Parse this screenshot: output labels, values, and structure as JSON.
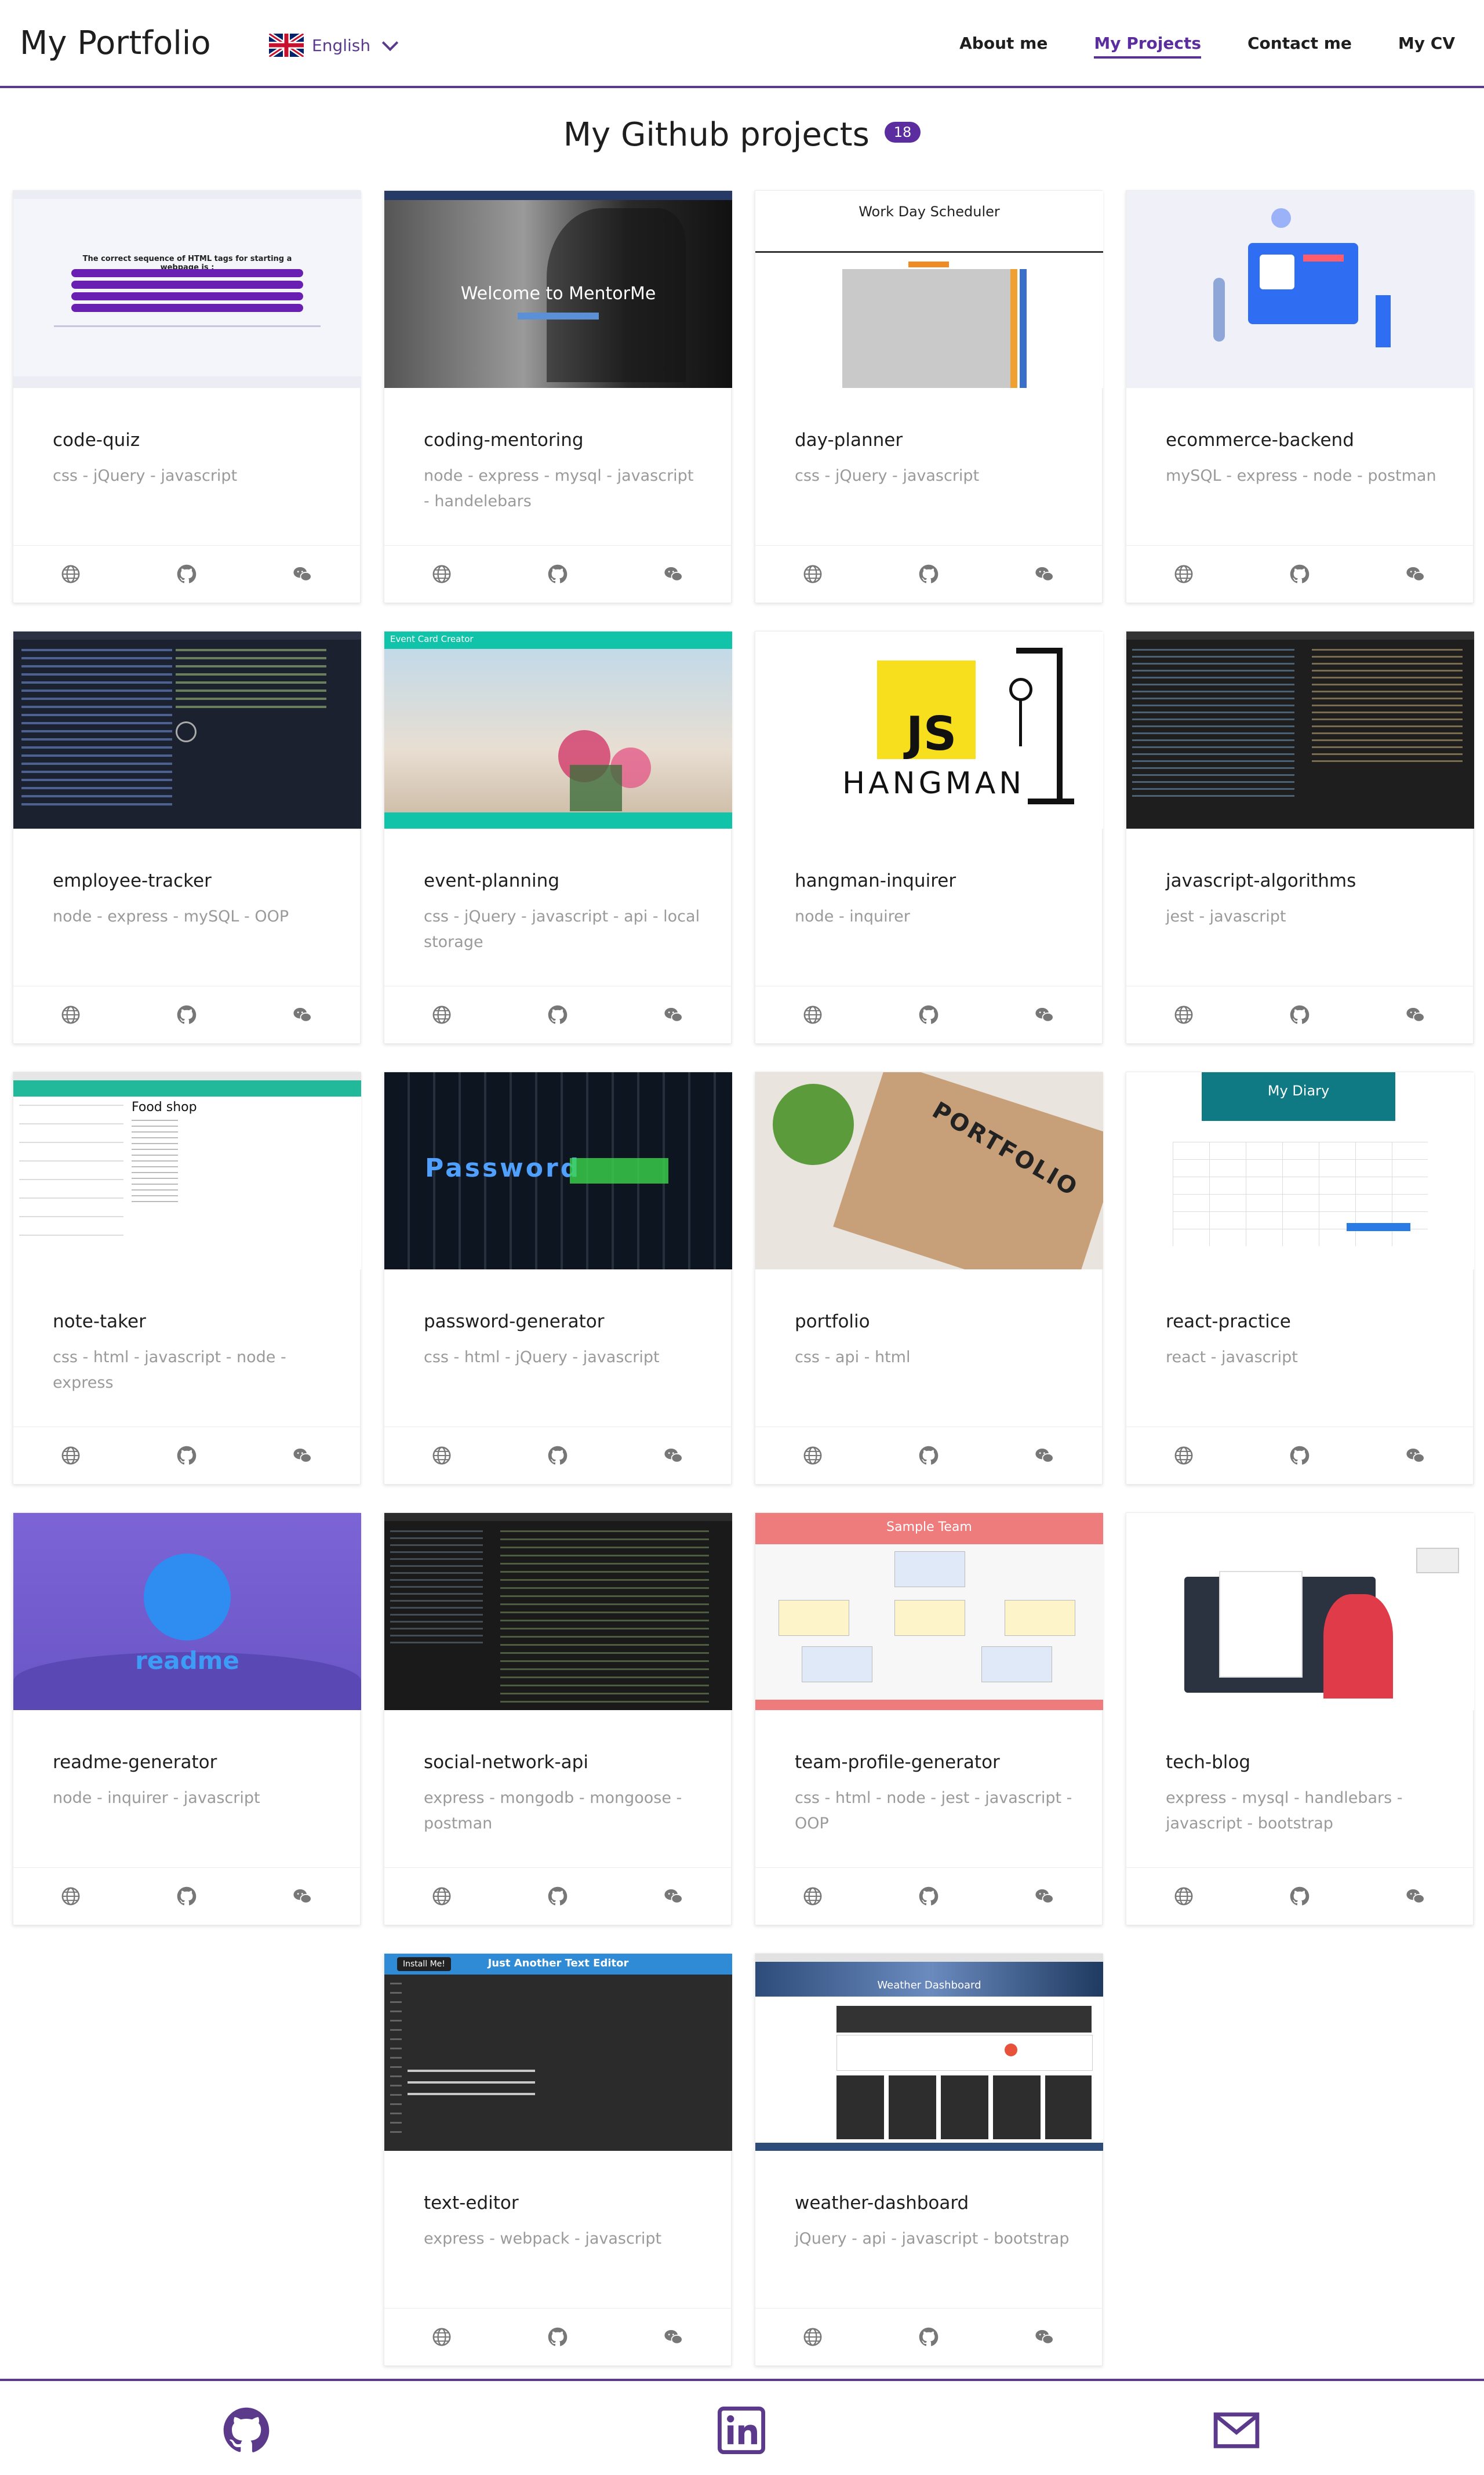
{
  "header": {
    "brand": "My Portfolio",
    "language": "English",
    "nav": [
      "About me",
      "My Projects",
      "Contact me",
      "My CV"
    ],
    "active_nav": "My Projects"
  },
  "section": {
    "title": "My Github projects",
    "count": "18"
  },
  "projects": [
    {
      "name": "code-quiz",
      "tech": "css - jQuery - javascript"
    },
    {
      "name": "coding-mentoring",
      "tech": "node - express - mysql - javascript - handelebars"
    },
    {
      "name": "day-planner",
      "tech": "css - jQuery - javascript"
    },
    {
      "name": "ecommerce-backend",
      "tech": "mySQL - express - node - postman"
    },
    {
      "name": "employee-tracker",
      "tech": "node - express - mySQL - OOP"
    },
    {
      "name": "event-planning",
      "tech": "css - jQuery - javascript - api - local storage"
    },
    {
      "name": "hangman-inquirer",
      "tech": "node - inquirer"
    },
    {
      "name": "javascript-algorithms",
      "tech": "jest - javascript"
    },
    {
      "name": "note-taker",
      "tech": "css - html - javascript - node - express"
    },
    {
      "name": "password-generator",
      "tech": "css - html - jQuery - javascript"
    },
    {
      "name": "portfolio",
      "tech": "css - api - html"
    },
    {
      "name": "react-practice",
      "tech": "react - javascript"
    },
    {
      "name": "readme-generator",
      "tech": "node - inquirer - javascript"
    },
    {
      "name": "social-network-api",
      "tech": "express - mongodb - mongoose - postman"
    },
    {
      "name": "team-profile-generator",
      "tech": "css - html - node - jest - javascript - OOP"
    },
    {
      "name": "tech-blog",
      "tech": "express - mysql - handlebars - javascript - bootstrap"
    },
    {
      "name": "text-editor",
      "tech": "express - webpack - javascript"
    },
    {
      "name": "weather-dashboard",
      "tech": "jQuery - api - javascript - bootstrap"
    }
  ],
  "thumb_text": {
    "mentor": "Welcome to MentorMe",
    "planner": "Work Day Scheduler",
    "event": "Event Card Creator",
    "hang_js": "JS",
    "hang_word": "HANGMAN",
    "note": "Food shop",
    "pass": "Password",
    "port": "PORTFOLIO",
    "react": "My Diary",
    "readme": "readme",
    "team": "Sample Team",
    "text_btn": "Install Me!",
    "text_title": "Just Another Text Editor",
    "weather": "Weather Dashboard",
    "quiz": "The correct sequence of HTML tags for starting a webpage is :"
  },
  "icons": {
    "card_footer": [
      "globe-icon",
      "github-icon",
      "wechat-icon"
    ],
    "footer": [
      "github-icon",
      "linkedin-icon",
      "mail-icon"
    ]
  },
  "colors": {
    "accent": "#5b2d9e",
    "border": "#5b3a8c"
  }
}
